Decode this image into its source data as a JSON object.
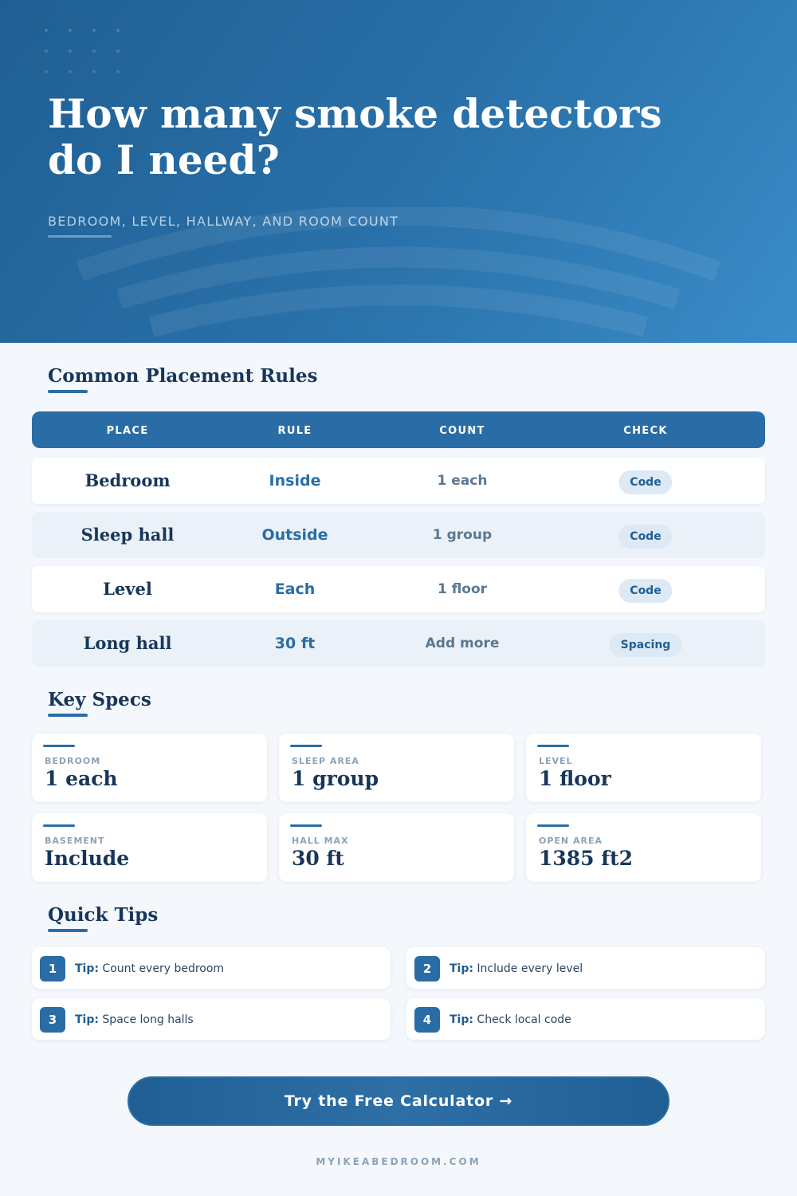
{
  "hero": {
    "title": "How many smoke detectors do I need?",
    "subtitle": "BEDROOM, LEVEL, HALLWAY, AND ROOM COUNT"
  },
  "rules": {
    "title": "Common Placement Rules",
    "headers": [
      "PLACE",
      "RULE",
      "COUNT",
      "CHECK"
    ],
    "rows": [
      {
        "place": "Bedroom",
        "rule": "Inside",
        "count": "1 each",
        "check": "Code"
      },
      {
        "place": "Sleep hall",
        "rule": "Outside",
        "count": "1 group",
        "check": "Code"
      },
      {
        "place": "Level",
        "rule": "Each",
        "count": "1 floor",
        "check": "Code"
      },
      {
        "place": "Long hall",
        "rule": "30 ft",
        "count": "Add more",
        "check": "Spacing"
      }
    ]
  },
  "specs": {
    "title": "Key Specs",
    "cards": [
      {
        "label": "BEDROOM",
        "value": "1 each"
      },
      {
        "label": "SLEEP AREA",
        "value": "1 group"
      },
      {
        "label": "LEVEL",
        "value": "1 floor"
      },
      {
        "label": "BASEMENT",
        "value": "Include"
      },
      {
        "label": "HALL MAX",
        "value": "30 ft"
      },
      {
        "label": "OPEN AREA",
        "value": "1385 ft2"
      }
    ]
  },
  "tips": {
    "title": "Quick Tips",
    "prefix": "Tip:",
    "items": [
      {
        "num": "1",
        "text": "Count every bedroom"
      },
      {
        "num": "2",
        "text": "Include every level"
      },
      {
        "num": "3",
        "text": "Space long halls"
      },
      {
        "num": "4",
        "text": "Check local code"
      }
    ]
  },
  "cta": {
    "label": "Try the Free Calculator →"
  },
  "footer": {
    "site": "MYIKEABEDROOM.COM"
  },
  "colors": {
    "hero_start": "#1f5f93",
    "hero_end": "#3a8cc8",
    "accent": "#2a6da6",
    "heading": "#17365a",
    "page_bg": "#f4f7fb",
    "row_tint": "#eaf1f8",
    "pill_bg": "#dde9f4"
  }
}
